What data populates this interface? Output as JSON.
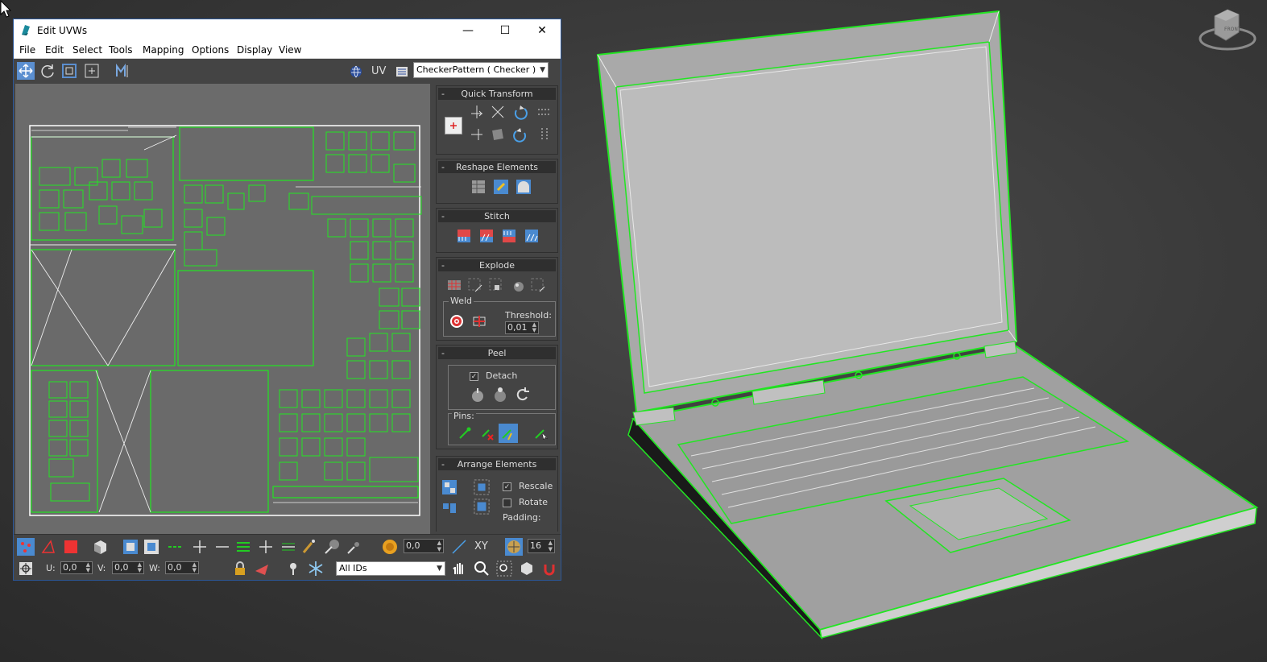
{
  "window": {
    "title": "Edit UVWs",
    "minimize": "—",
    "maximize": "☐",
    "close": "✕"
  },
  "menu": [
    "File",
    "Edit",
    "Select",
    "Tools",
    "Mapping",
    "Options",
    "Display",
    "View"
  ],
  "toolbar": {
    "uv_label": "UV",
    "texture_dropdown": "CheckerPattern  ( Checker )"
  },
  "rollouts": {
    "quick_transform": "Quick Transform",
    "reshape_elements": "Reshape Elements",
    "stitch": "Stitch",
    "explode": "Explode",
    "peel": "Peel",
    "arrange_elements": "Arrange Elements"
  },
  "explode": {
    "weld_label": "Weld",
    "threshold_label": "Threshold:",
    "threshold_value": "0,01"
  },
  "peel": {
    "detach_label": "Detach",
    "detach_checked": "✓",
    "pins_label": "Pins:"
  },
  "arrange": {
    "rescale_label": "Rescale",
    "rescale_checked": "✓",
    "rotate_label": "Rotate",
    "padding_label": "Padding:"
  },
  "bottom": {
    "soft_value": "0,0",
    "xy_label": "XY",
    "grid_value": "16",
    "u_label": "U:",
    "u_value": "0,0",
    "v_label": "V:",
    "v_value": "0,0",
    "w_label": "W:",
    "w_value": "0,0",
    "id_dropdown": "All IDs"
  },
  "viewcube_label": "FRONT",
  "colors": {
    "accent": "#5b8fd0",
    "wire_green": "#22e622",
    "uv_bg": "#6b6b6b",
    "panel_bg": "#444444"
  }
}
